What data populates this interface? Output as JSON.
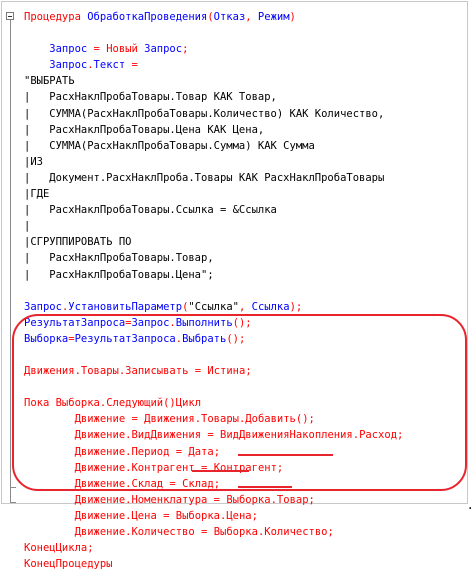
{
  "code_lines": [
    [
      [
        "Процедура ",
        "k"
      ],
      [
        "ОбработкаПроведения",
        "v"
      ],
      [
        "(",
        "o"
      ],
      [
        "Отказ",
        "v"
      ],
      [
        ", ",
        "o"
      ],
      [
        "Режим",
        "v"
      ],
      [
        ")",
        "o"
      ]
    ],
    [],
    [
      [
        "    Запрос ",
        "v"
      ],
      [
        "= ",
        "o"
      ],
      [
        "Новый ",
        "k"
      ],
      [
        "Запрос",
        "v"
      ],
      [
        ";",
        "o"
      ]
    ],
    [
      [
        "    Запрос",
        "v"
      ],
      [
        ".",
        "o"
      ],
      [
        "Текст ",
        "v"
      ],
      [
        "=",
        "o"
      ]
    ],
    [
      [
        "\"ВЫБРАТЬ",
        "s"
      ]
    ],
    [
      [
        "|   РасхНаклПробаТовары.Товар КАК Товар,",
        "s"
      ]
    ],
    [
      [
        "|   СУММА(РасхНаклПробаТовары.Количество) КАК Количество,",
        "s"
      ]
    ],
    [
      [
        "|   РасхНаклПробаТовары.Цена КАК Цена,",
        "s"
      ]
    ],
    [
      [
        "|   СУММА(РасхНаклПробаТовары.Сумма) КАК Сумма",
        "s"
      ]
    ],
    [
      [
        "|ИЗ",
        "s"
      ]
    ],
    [
      [
        "|   Документ.РасхНаклПроба.Товары КАК РасхНаклПробаТовары",
        "s"
      ]
    ],
    [
      [
        "|ГДЕ",
        "s"
      ]
    ],
    [
      [
        "|   РасхНаклПробаТовары.Ссылка = &Ссылка",
        "s"
      ]
    ],
    [
      [
        "|",
        "s"
      ]
    ],
    [
      [
        "|СГРУППИРОВАТЬ ПО",
        "s"
      ]
    ],
    [
      [
        "|   РасхНаклПробаТовары.Товар,",
        "s"
      ]
    ],
    [
      [
        "|   РасхНаклПробаТовары.Цена\";",
        "s"
      ]
    ],
    [],
    [
      [
        "Запрос",
        "v"
      ],
      [
        ".",
        "o"
      ],
      [
        "УстановитьПараметр",
        "v"
      ],
      [
        "(",
        "o"
      ],
      [
        "\"Ссылка\"",
        "s"
      ],
      [
        ", ",
        "o"
      ],
      [
        "Ссылка",
        "v"
      ],
      [
        ");",
        "o"
      ]
    ],
    [
      [
        "РезультатЗапроса",
        "v"
      ],
      [
        "=",
        "o"
      ],
      [
        "Запрос",
        "v"
      ],
      [
        ".",
        "o"
      ],
      [
        "Выполнить",
        "v"
      ],
      [
        "();",
        "o"
      ]
    ],
    [
      [
        "Выборка",
        "v"
      ],
      [
        "=",
        "o"
      ],
      [
        "РезультатЗапроса",
        "v"
      ],
      [
        ".",
        "o"
      ],
      [
        "Выбрать",
        "v"
      ],
      [
        "();",
        "o"
      ]
    ],
    [],
    [
      [
        "Движения",
        "k"
      ],
      [
        ".",
        "k"
      ],
      [
        "Товары",
        "k"
      ],
      [
        ".",
        "k"
      ],
      [
        "Записывать ",
        "k"
      ],
      [
        "= ",
        "k"
      ],
      [
        "Истина",
        "k"
      ],
      [
        ";",
        "k"
      ]
    ],
    [],
    [
      [
        "Пока ",
        "k"
      ],
      [
        "Выборка",
        "k"
      ],
      [
        ".",
        "k"
      ],
      [
        "Следующий",
        "k"
      ],
      [
        "()",
        "k"
      ],
      [
        "Цикл",
        "k"
      ]
    ],
    [
      [
        "        Движение ",
        "k"
      ],
      [
        "= ",
        "k"
      ],
      [
        "Движения",
        "k"
      ],
      [
        ".",
        "k"
      ],
      [
        "Товары",
        "k"
      ],
      [
        ".",
        "k"
      ],
      [
        "Добавить",
        "k"
      ],
      [
        "();",
        "k"
      ]
    ],
    [
      [
        "        Движение",
        "k"
      ],
      [
        ".",
        "k"
      ],
      [
        "ВидДвижения ",
        "k"
      ],
      [
        "= ",
        "k"
      ],
      [
        "ВидДвиженияНакопления",
        "k"
      ],
      [
        ".",
        "k"
      ],
      [
        "Расход",
        "k"
      ],
      [
        ";",
        "k"
      ]
    ],
    [
      [
        "        Движение",
        "k"
      ],
      [
        ".",
        "k"
      ],
      [
        "Период ",
        "k"
      ],
      [
        "= ",
        "k"
      ],
      [
        "Дата",
        "k"
      ],
      [
        ";",
        "k"
      ]
    ],
    [
      [
        "        Движение",
        "k"
      ],
      [
        ".",
        "k"
      ],
      [
        "Контрагент ",
        "k"
      ],
      [
        "= ",
        "k"
      ],
      [
        "Контрагент",
        "k"
      ],
      [
        ";",
        "k"
      ]
    ],
    [
      [
        "        Движение",
        "k"
      ],
      [
        ".",
        "k"
      ],
      [
        "Склад ",
        "k"
      ],
      [
        "= ",
        "k"
      ],
      [
        "Склад",
        "k"
      ],
      [
        ";",
        "k"
      ]
    ],
    [
      [
        "        Движение",
        "k"
      ],
      [
        ".",
        "k"
      ],
      [
        "Номенклатура ",
        "k"
      ],
      [
        "= ",
        "k"
      ],
      [
        "Выборка",
        "k"
      ],
      [
        ".",
        "k"
      ],
      [
        "Товар",
        "k"
      ],
      [
        ";",
        "k"
      ]
    ],
    [
      [
        "        Движение",
        "k"
      ],
      [
        ".",
        "k"
      ],
      [
        "Цена ",
        "k"
      ],
      [
        "= ",
        "k"
      ],
      [
        "Выборка",
        "k"
      ],
      [
        ".",
        "k"
      ],
      [
        "Цена",
        "k"
      ],
      [
        ";",
        "k"
      ]
    ],
    [
      [
        "        Движение",
        "k"
      ],
      [
        ".",
        "k"
      ],
      [
        "Количество ",
        "k"
      ],
      [
        "= ",
        "k"
      ],
      [
        "Выборка",
        "k"
      ],
      [
        ".",
        "k"
      ],
      [
        "Количество",
        "k"
      ],
      [
        ";",
        "k"
      ]
    ],
    [
      [
        "КонецЦикла",
        "k"
      ],
      [
        ";",
        "k"
      ]
    ],
    [
      [
        "КонецПроцедуры",
        "k"
      ]
    ]
  ],
  "colors": {
    "keyword": "#ff0000",
    "identifier": "#0000ff",
    "string": "#000000",
    "annotation": "#e8242c"
  },
  "trailing_mark": "."
}
